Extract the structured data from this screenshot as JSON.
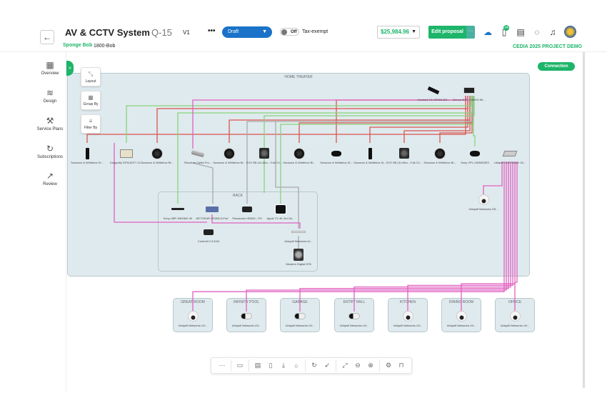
{
  "header": {
    "back_icon": "arrow-left-icon",
    "title": "AV & CCTV System",
    "quote_number": "Q-15",
    "version": "V1",
    "more": "•••",
    "status": "Draft",
    "tax_toggle": "Off",
    "tax_label": "Tax-exempt",
    "client_name": "Sponge Bob",
    "client_phone": "1800-Bob",
    "price": "$25,984.96",
    "edit_label": "Edit proposal",
    "edit_more": "···",
    "project": "CEDIA 2025 PROJECT DEMO",
    "notification_badge": "24",
    "icons": [
      "cloud-icon",
      "book-icon",
      "calendar-icon",
      "chat-icon",
      "bell-icon",
      "avatar"
    ]
  },
  "sidebar": {
    "items": [
      {
        "label": "Overview",
        "icon": "grid-icon"
      },
      {
        "label": "Design",
        "icon": "layers-icon"
      },
      {
        "label": "Service Plans",
        "icon": "wrench-icon"
      },
      {
        "label": "Subscriptions",
        "icon": "refresh-dollar-icon"
      },
      {
        "label": "Review",
        "icon": "chart-icon"
      }
    ]
  },
  "canvas_tools": {
    "layout": "Layout",
    "group_by": "Group By",
    "filter_by": "Filter By",
    "connection": "Connection"
  },
  "groups": {
    "home_theater": "HOME THEATER",
    "rack": "RACK",
    "rooms": [
      "GREAT ROOM",
      "INFINITY POOL",
      "GARAGE",
      "ENTRY HALL",
      "KITCHEN",
      "DINING ROOM",
      "OFFICE"
    ]
  },
  "devices": {
    "top": [
      "Control4 C4-SR260-BO...",
      "Denon AVR-X4800H 8K..."
    ],
    "row": [
      "Sonance & Whitebox Di...",
      "Dragonfly DFM-6077-12...",
      "Sonance & Whitebox Bl...",
      "Structure Cable Fro...",
      "Sonance & Whitebox Bl...",
      "SVS SB-16-Ultra - 9 ALCX...",
      "Sonance & Whitebox Bl...",
      "Sonance & Whitebox Di...",
      "Sonance & Whitebox Di...",
      "SVS SB-16-Ultra - 9 ALCX...",
      "Sonance & Whitebox Bl...",
      "Sony VPL-XW5000ES",
      "Ubiquiti Unifi Switch 16..."
    ],
    "ht_camera": "Ubiquiti Networks G5...",
    "rack": [
      "Sony UBP-X800M2 4K",
      "NETGEAR GS308 8-Port",
      "Panasonic HD600 - PH",
      "Apple TV 4K 3rd Ge...",
      "Control4 C4-EA3",
      "Ubiquiti Networks Ul...",
      "Western Digital 8TB",
      "Western Digital HDD 4..."
    ],
    "rooms": [
      "Ubiquiti Networks UV...",
      "Ubiquiti Networks UV...",
      "Ubiquiti Networks UV...",
      "Ubiquiti Networks UV...",
      "Ubiquiti Networks UV...",
      "Ubiquiti Networks UV...",
      "Ubiquiti Networks UV..."
    ]
  },
  "bottom_toolbar": [
    "apps-icon",
    "folder-icon",
    "document-icon",
    "file-icon",
    "download-icon",
    "search-icon",
    "refresh-icon",
    "pointer-icon",
    "fit-screen-icon",
    "zoom-out-icon",
    "zoom-in-icon",
    "settings-icon",
    "unlock-icon"
  ],
  "colors": {
    "accent": "#1db56a",
    "status_blue": "#1a73c8",
    "wire_speaker": "#d9534f",
    "wire_hdmi": "#86d47a",
    "wire_network": "#e060c0",
    "wire_other": "#aaaaaa",
    "group_bg": "#dfeaee"
  }
}
